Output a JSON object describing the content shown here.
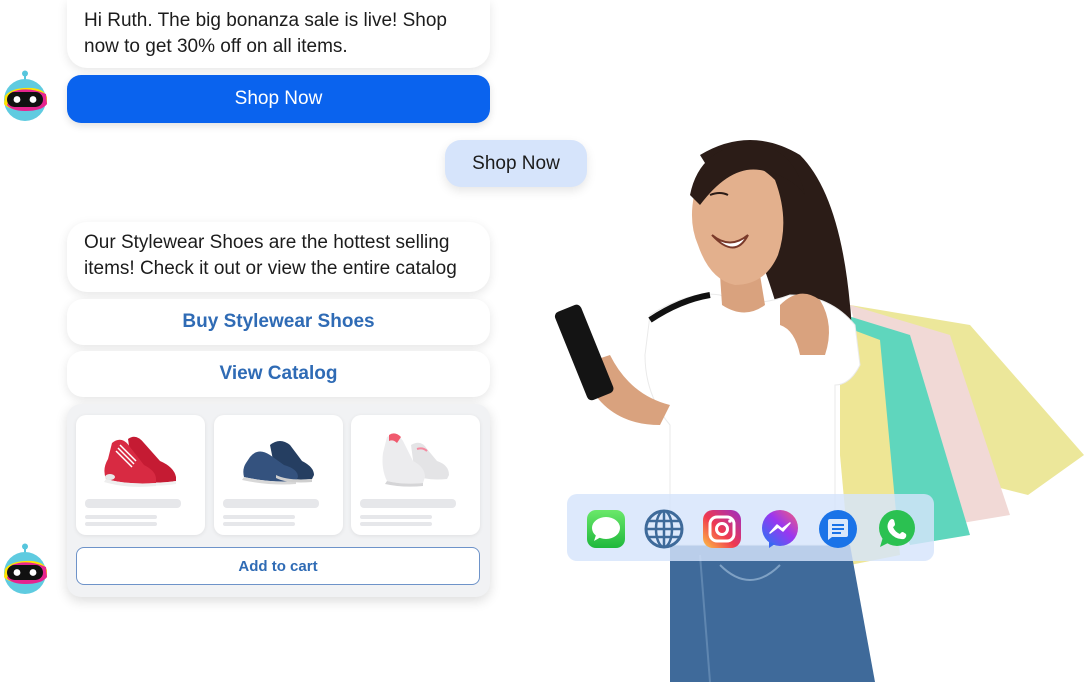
{
  "conversation": {
    "bot_message_1": {
      "line1": "Hi Ruth. The big bonanza sale is live! Shop",
      "line2": "now to get 30% off on all items."
    },
    "primary_button_label": "Shop Now",
    "user_reply": "Shop Now",
    "bot_message_2": {
      "line1": "Our Stylewear Shoes are the hottest selling",
      "line2": "items! Check it out or view the entire catalog"
    },
    "quick_replies": [
      {
        "label": "Buy Stylewear Shoes"
      },
      {
        "label": "View Catalog"
      }
    ],
    "product_carousel": {
      "products": [
        {
          "name": "red-canvas-sneakers",
          "color": "#d3203a"
        },
        {
          "name": "navy-leather-oxfords",
          "color": "#2e4a72"
        },
        {
          "name": "white-sneakers",
          "color": "#e3e3e5"
        }
      ],
      "add_to_cart_label": "Add to cart"
    }
  },
  "channels": [
    {
      "icon": "imessage-icon",
      "color": "#34c759"
    },
    {
      "icon": "web-globe-icon",
      "color": "#3e6a9a"
    },
    {
      "icon": "instagram-icon",
      "color": "#d62976"
    },
    {
      "icon": "messenger-icon",
      "color": "#8a3ffc"
    },
    {
      "icon": "rcs-messages-icon",
      "color": "#1a73e8"
    },
    {
      "icon": "whatsapp-icon",
      "color": "#25d366"
    }
  ],
  "colors": {
    "primary": "#0a63ee",
    "user_bubble": "#d6e4fb",
    "link_text": "#2f6bb5"
  }
}
